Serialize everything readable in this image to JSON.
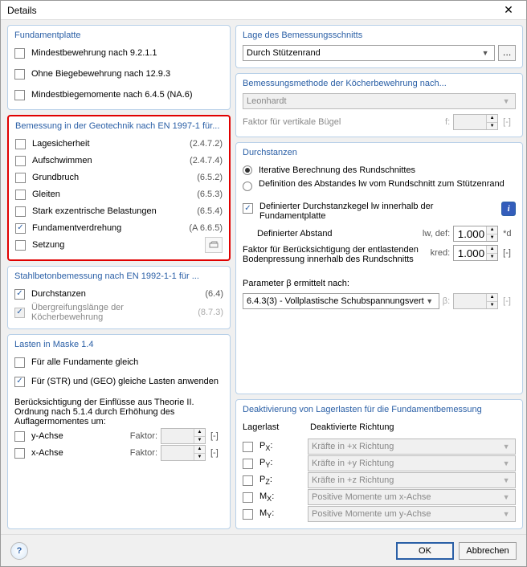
{
  "window": {
    "title": "Details"
  },
  "fundamentplatte": {
    "title": "Fundamentplatte",
    "items": [
      {
        "label": "Mindestbewehrung nach 9.2.1.1",
        "checked": false
      },
      {
        "label": "Ohne Biegebewehrung nach 12.9.3",
        "checked": false
      },
      {
        "label": "Mindestbiegemomente nach 6.4.5 (NA.6)",
        "checked": false
      }
    ]
  },
  "geotechnik": {
    "title": "Bemessung in der Geotechnik nach EN 1997-1 für...",
    "items": [
      {
        "label": "Lagesicherheit",
        "ref": "(2.4.7.2)",
        "checked": false
      },
      {
        "label": "Aufschwimmen",
        "ref": "(2.4.7.4)",
        "checked": false
      },
      {
        "label": "Grundbruch",
        "ref": "(6.5.2)",
        "checked": false
      },
      {
        "label": "Gleiten",
        "ref": "(6.5.3)",
        "checked": false
      },
      {
        "label": "Stark exzentrische Belastungen",
        "ref": "(6.5.4)",
        "checked": false
      },
      {
        "label": "Fundamentverdrehung",
        "ref": "(A 6.6.5)",
        "checked": true
      },
      {
        "label": "Setzung",
        "ref": "",
        "checked": false
      }
    ]
  },
  "stahlbeton": {
    "title": "Stahlbetonbemessung nach EN 1992-1-1 für ...",
    "items": [
      {
        "label": "Durchstanzen",
        "ref": "(6.4)",
        "checked": true
      },
      {
        "label": "Übergreifungslänge der Köcherbewehrung",
        "ref": "(8.7.3)",
        "checked": true,
        "disabled": true
      }
    ]
  },
  "lasten": {
    "title": "Lasten in Maske 1.4",
    "alle": {
      "label": "Für alle Fundamente gleich",
      "checked": false
    },
    "strgeo": {
      "label": "Für (STR) und (GEO) gleiche Lasten anwenden",
      "checked": true
    },
    "note": "Berücksichtigung der Einflüsse aus Theorie II. Ordnung nach 5.1.4 durch Erhöhung des Auflagermomentes um:",
    "axes": [
      {
        "label": "y-Achse",
        "faktor_label": "Faktor:",
        "unit": "[-]"
      },
      {
        "label": "x-Achse",
        "faktor_label": "Faktor:",
        "unit": "[-]"
      }
    ]
  },
  "lage": {
    "title": "Lage des Bemessungsschnitts",
    "selected": "Durch Stützenrand"
  },
  "koecher": {
    "title": "Bemessungsmethode der Köcherbewehrung nach...",
    "selected": "Leonhardt",
    "faktor_label": "Faktor für vertikale Bügel",
    "faktor_sym": "f:",
    "faktor_unit": "[-]"
  },
  "durchstanzen": {
    "title": "Durchstanzen",
    "opt1": "Iterative Berechnung des Rundschnittes",
    "opt2": "Definition des Abstandes lw vom Rundschnitt zum Stützenrand",
    "cb1": "Definierter Durchstanzkegel lw innerhalb der Fundamentplatte",
    "def_abstand_label": "Definierter Abstand",
    "def_abstand_sym": "lw, def:",
    "def_abstand_val": "1.000",
    "def_abstand_unit": "*d",
    "kred_label": "Faktor für Berücksichtigung der entlastenden Bodenpressung innerhalb des Rundschnitts",
    "kred_sym": "kred:",
    "kred_val": "1.000",
    "kred_unit": "[-]",
    "param_label": "Parameter β ermittelt nach:",
    "param_selected": "6.4.3(3) - Vollplastische Schubspannungsvert",
    "beta_sym": "β:",
    "beta_unit": "[-]"
  },
  "deaktivierung": {
    "title": "Deaktivierung von Lagerlasten für die Fundamentbemessung",
    "col1": "Lagerlast",
    "col2": "Deaktivierte Richtung",
    "rows": [
      {
        "sym": "Px:",
        "dir": "Kräfte in +x Richtung"
      },
      {
        "sym": "Py:",
        "dir": "Kräfte in +y Richtung"
      },
      {
        "sym": "Pz:",
        "dir": "Kräfte in +z Richtung"
      },
      {
        "sym": "Mx:",
        "dir": "Positive Momente um x-Achse"
      },
      {
        "sym": "My:",
        "dir": "Positive Momente um y-Achse"
      }
    ]
  },
  "footer": {
    "ok": "OK",
    "cancel": "Abbrechen"
  }
}
